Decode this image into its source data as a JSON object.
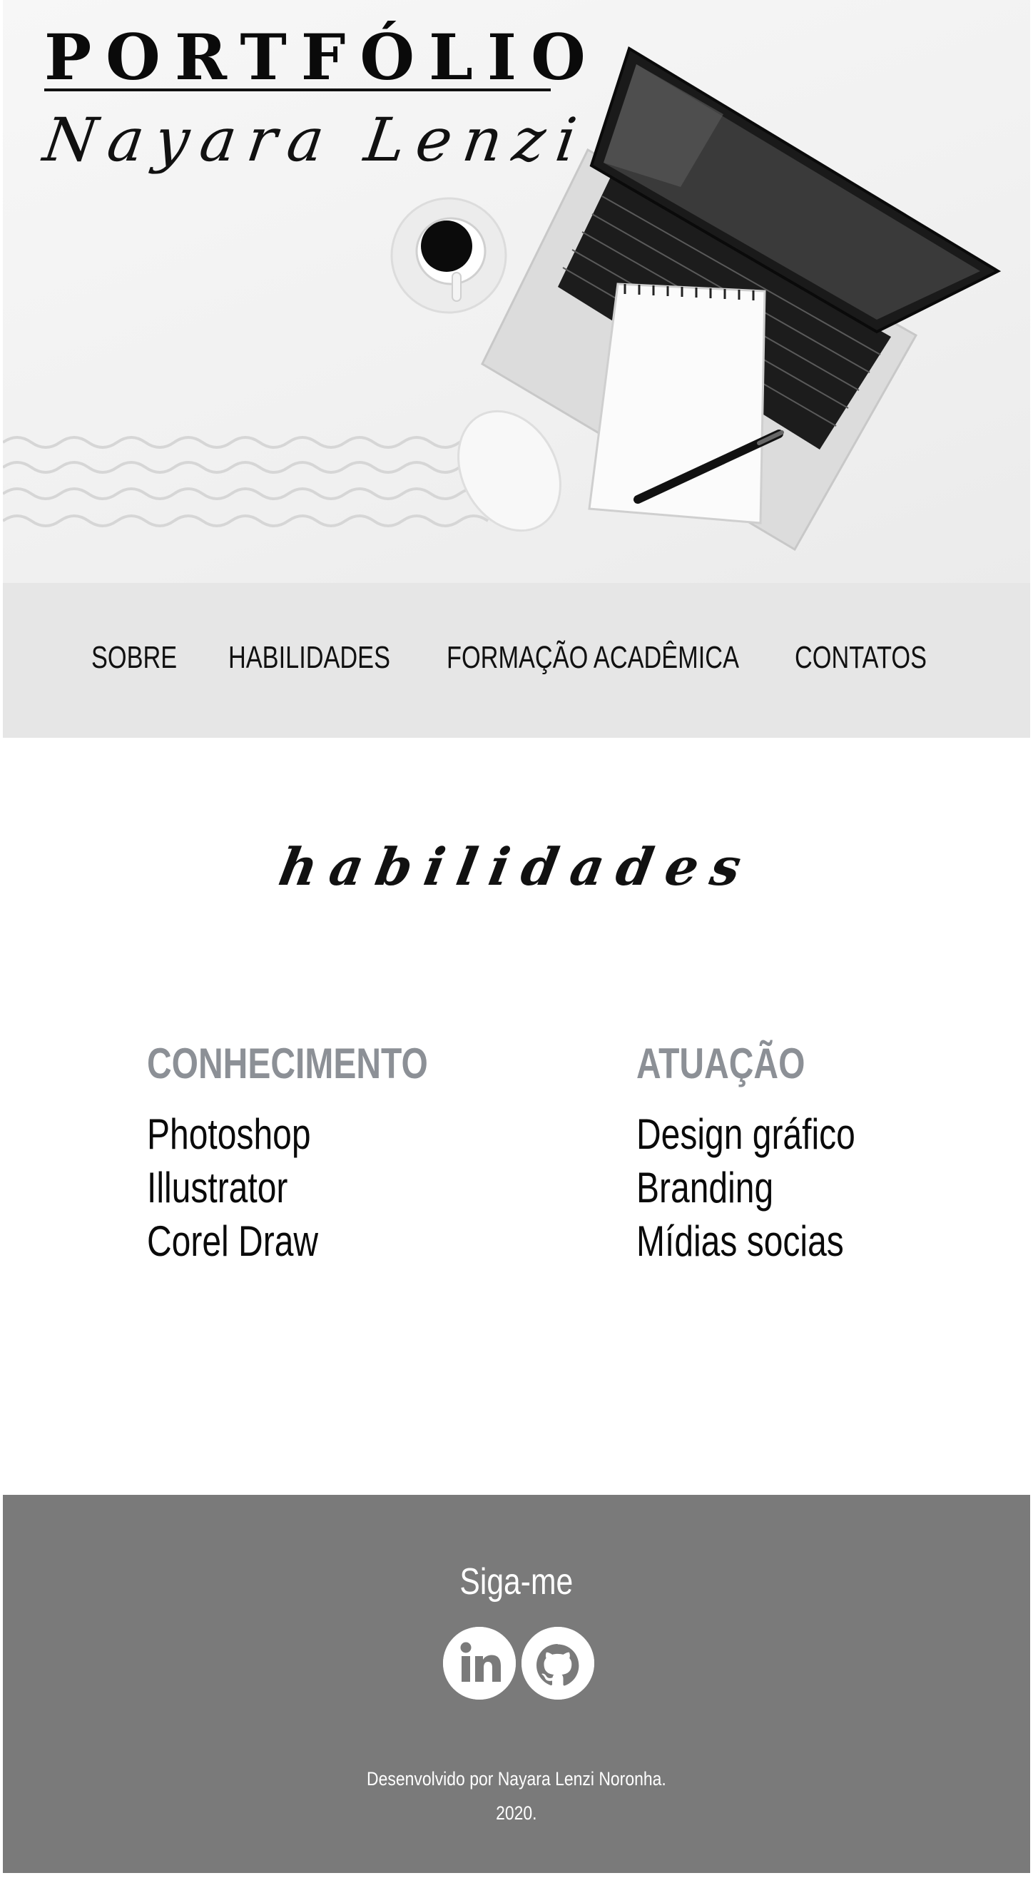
{
  "header": {
    "title": "PORTFÓLIO",
    "signature": "Nayara Lenzi"
  },
  "nav": {
    "items": [
      {
        "label": "SOBRE"
      },
      {
        "label": "HABILIDADES"
      },
      {
        "label": "FORMAÇÃO ACADÊMICA"
      },
      {
        "label": "CONTATOS"
      }
    ]
  },
  "skills": {
    "title": "habilidades",
    "knowledge": {
      "heading": "CONHECIMENTO",
      "items": [
        "Photoshop",
        "Illustrator",
        "Corel Draw"
      ]
    },
    "practice": {
      "heading": "ATUAÇÃO",
      "items": [
        "Design gráfico",
        "Branding",
        "Mídias socias"
      ]
    }
  },
  "footer": {
    "follow_label": "Siga-me",
    "social": [
      {
        "icon": "linkedin-icon"
      },
      {
        "icon": "github-icon"
      }
    ],
    "credit_line1": "Desenvolvido por Nayara Lenzi Noronha.",
    "credit_line2": "2020."
  },
  "colors": {
    "nav_bg": "#e6e6e6",
    "footer_bg": "#7a7a7a",
    "heading_gray": "#8c9096"
  }
}
